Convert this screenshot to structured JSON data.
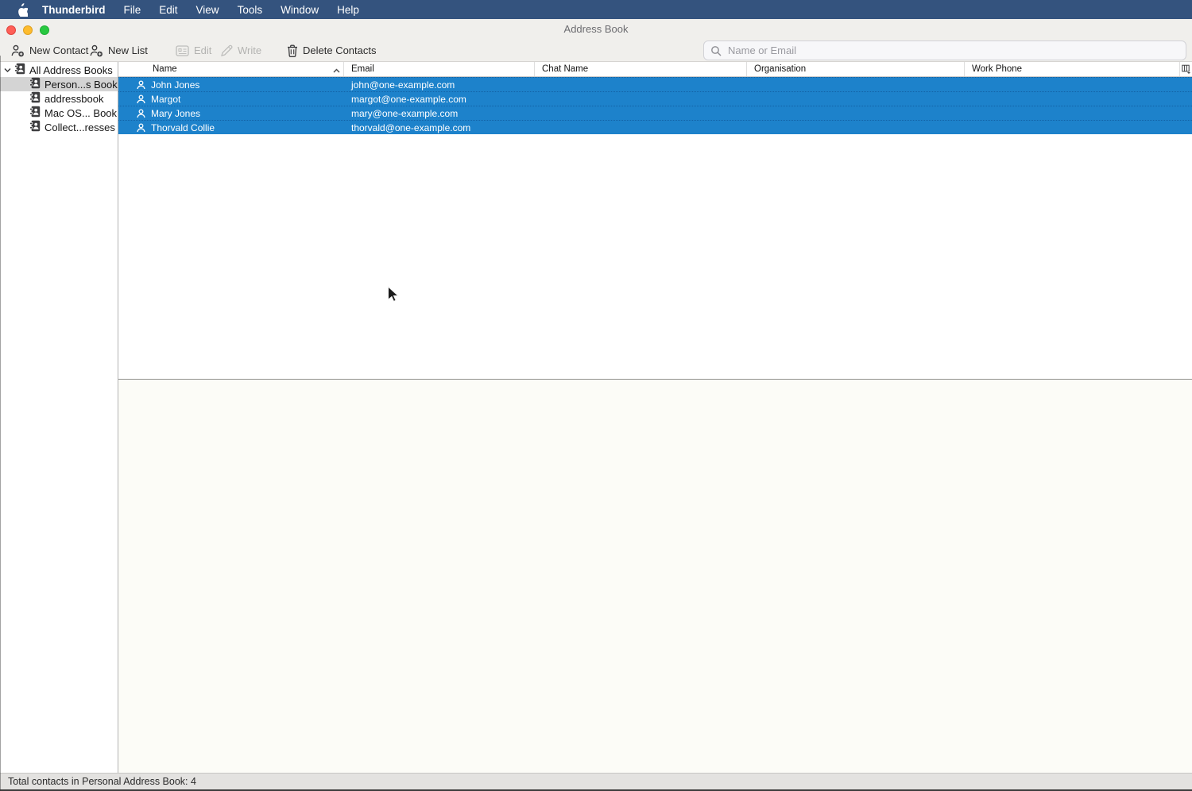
{
  "menu_bar": {
    "app_name": "Thunderbird",
    "items": [
      "File",
      "Edit",
      "View",
      "Tools",
      "Window",
      "Help"
    ]
  },
  "window": {
    "title": "Address Book"
  },
  "toolbar": {
    "new_contact": "New Contact",
    "new_list": "New List",
    "edit": "Edit",
    "write": "Write",
    "delete_contacts": "Delete Contacts",
    "search_placeholder": "Name or Email"
  },
  "sidebar": {
    "items": [
      {
        "label": "All Address Books",
        "level": 0,
        "selected": false,
        "expanded": true
      },
      {
        "label": "Person...s Book",
        "level": 1,
        "selected": true
      },
      {
        "label": "addressbook",
        "level": 1,
        "selected": false
      },
      {
        "label": "Mac OS... Book",
        "level": 1,
        "selected": false
      },
      {
        "label": "Collect...resses",
        "level": 1,
        "selected": false
      }
    ]
  },
  "table": {
    "columns": [
      "Name",
      "Email",
      "Chat Name",
      "Organisation",
      "Work Phone"
    ],
    "sort": {
      "column": "Name",
      "direction": "ascending"
    },
    "rows": [
      {
        "name": "John Jones",
        "email": "john@one-example.com",
        "chat_name": "",
        "organisation": "",
        "work_phone": "",
        "selected": true
      },
      {
        "name": "Margot",
        "email": "margot@one-example.com",
        "chat_name": "",
        "organisation": "",
        "work_phone": "",
        "selected": true
      },
      {
        "name": "Mary Jones",
        "email": "mary@one-example.com",
        "chat_name": "",
        "organisation": "",
        "work_phone": "",
        "selected": true
      },
      {
        "name": "Thorvald Collie",
        "email": "thorvald@one-example.com",
        "chat_name": "",
        "organisation": "",
        "work_phone": "",
        "selected": true
      }
    ]
  },
  "status_bar": {
    "text": "Total contacts in Personal Address Book: 4"
  },
  "colors": {
    "menubar_bg": "#34537e",
    "selection_blue": "#1d82cb",
    "sidebar_selection_gray": "#d4d4d4",
    "traffic_red": "#ff5f57",
    "traffic_yellow": "#febc2e",
    "traffic_green": "#28c840"
  }
}
